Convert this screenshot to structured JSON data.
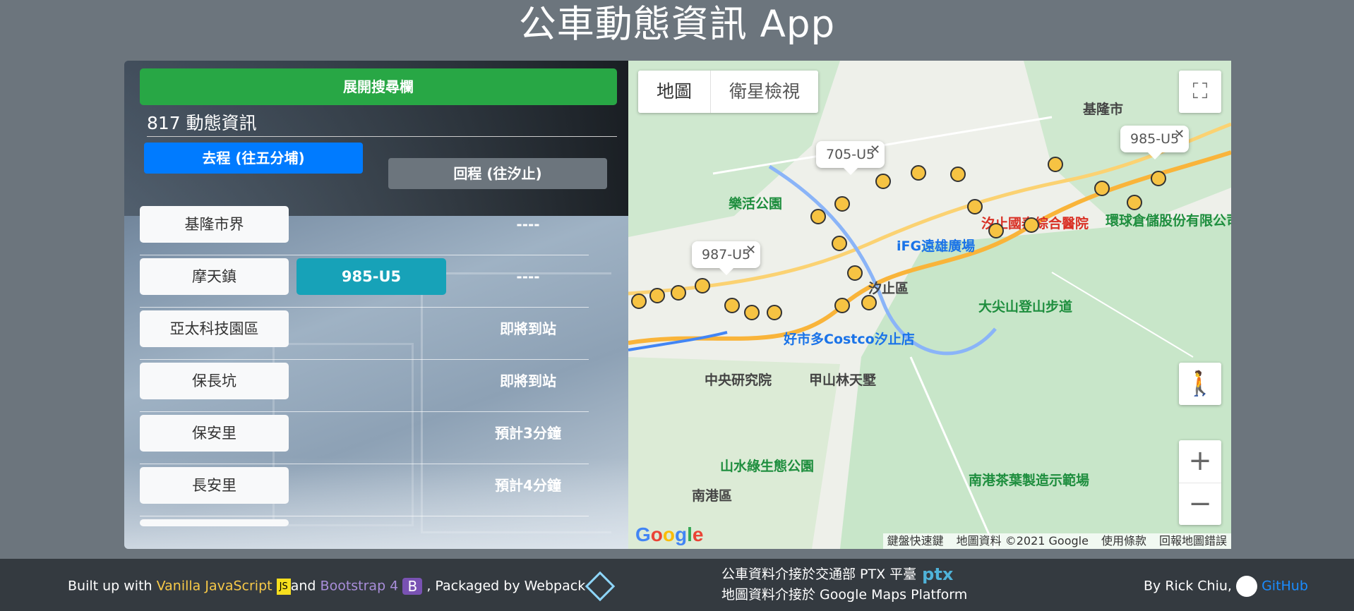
{
  "page_title": "公車動態資訊 App",
  "panel": {
    "expand_label": "展開搜尋欄",
    "route_title": "817 動態資訊",
    "direction_go": "去程 (往五分埔)",
    "direction_back": "回程 (往汐止)",
    "stops": [
      {
        "name": "基隆市界",
        "bus": "",
        "status": "----"
      },
      {
        "name": "摩天鎮",
        "bus": "985-U5",
        "status": "----"
      },
      {
        "name": "亞太科技園區",
        "bus": "",
        "status": "即將到站"
      },
      {
        "name": "保長坑",
        "bus": "",
        "status": "即將到站"
      },
      {
        "name": "保安里",
        "bus": "",
        "status": "預計3分鐘"
      },
      {
        "name": "長安里",
        "bus": "",
        "status": "預計4分鐘"
      }
    ]
  },
  "map": {
    "type_map": "地圖",
    "type_satellite": "衛星檢視",
    "fullscreen_icon": "⛶",
    "pegman_icon": "🚶",
    "zoom_in": "+",
    "zoom_out": "−",
    "infowindows": [
      {
        "label": "705-U5",
        "close": "✕"
      },
      {
        "label": "987-U5",
        "close": "✕"
      },
      {
        "label": "985-U5",
        "close": "✕"
      }
    ],
    "pois": {
      "p1": "樂活公園",
      "p2": "iFG遠雄廣場",
      "p3": "汐止國泰綜合醫院",
      "p4": "環球倉儲股份有限公司",
      "p5": "大尖山登山步道",
      "p6": "好市多Costco汐止店",
      "p7": "中央研究院",
      "p8": "甲山林天墅",
      "p9": "山水綠生態公園",
      "p10": "南港茶葉製造示範場",
      "p11": "南港區",
      "p12": "汐止區",
      "p13": "基隆市"
    },
    "logo": "Google",
    "footer": {
      "shortcuts": "鍵盤快速鍵",
      "data": "地圖資料 ©2021 Google",
      "terms": "使用條款",
      "report": "回報地圖錯誤"
    }
  },
  "footer": {
    "built_prefix": "Built up with ",
    "vanilla": "Vanilla JavaScript",
    "js_badge": "JS",
    "and": "and ",
    "bootstrap": "Bootstrap 4",
    "b_badge": "B",
    "packaged": " , Packaged by Webpack",
    "ptx_line": "公車資料介接於交通部 PTX 平臺",
    "ptx_logo": "ptx",
    "maps_line": "地圖資料介接於 Google Maps Platform",
    "by": "By Rick Chiu,",
    "github": "GitHub"
  }
}
